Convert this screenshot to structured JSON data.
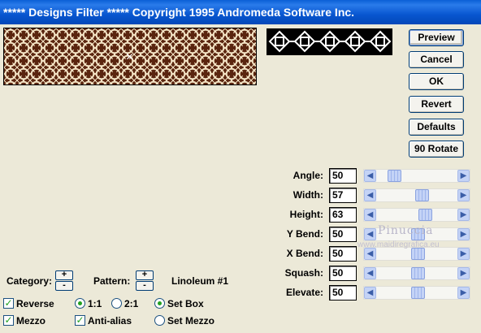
{
  "window": {
    "title": "***** Designs Filter *****  Copyright 1995 Andromeda Software Inc."
  },
  "buttons": [
    {
      "label": "Preview"
    },
    {
      "label": "Cancel"
    },
    {
      "label": "OK"
    },
    {
      "label": "Revert"
    },
    {
      "label": "Defaults"
    },
    {
      "label": "90 Rotate"
    }
  ],
  "sliders": [
    {
      "label": "Angle:",
      "value": "50",
      "fraction": 0.12
    },
    {
      "label": "Width:",
      "value": "57",
      "fraction": 0.57
    },
    {
      "label": "Height:",
      "value": "63",
      "fraction": 0.63
    },
    {
      "label": "Y Bend:",
      "value": "50",
      "fraction": 0.5
    },
    {
      "label": "X Bend:",
      "value": "50",
      "fraction": 0.5
    },
    {
      "label": "Squash:",
      "value": "50",
      "fraction": 0.5
    },
    {
      "label": "Elevate:",
      "value": "50",
      "fraction": 0.5
    }
  ],
  "category": {
    "label": "Category:",
    "plus": "+",
    "minus": "-"
  },
  "pattern": {
    "label": "Pattern:",
    "plus": "+",
    "minus": "-",
    "name": "Linoleum #1"
  },
  "options": {
    "reverse": {
      "label": "Reverse",
      "checked": true
    },
    "mezzo": {
      "label": "Mezzo",
      "checked": true
    },
    "ratio_1_1": {
      "label": "1:1",
      "selected": true
    },
    "ratio_2_1": {
      "label": "2:1",
      "selected": false
    },
    "anti_alias": {
      "label": "Anti-alias",
      "checked": true
    },
    "set_box": {
      "label": "Set Box",
      "selected": true
    },
    "set_mezzo": {
      "label": "Set Mezzo",
      "selected": false
    }
  },
  "watermark": {
    "name": "Pinuccia",
    "url": "www.maidiregrafica.eu"
  },
  "colors": {
    "pattern_dark": "#5a250f",
    "pattern_light": "#f3e3c4",
    "accent": "#0856d0"
  }
}
